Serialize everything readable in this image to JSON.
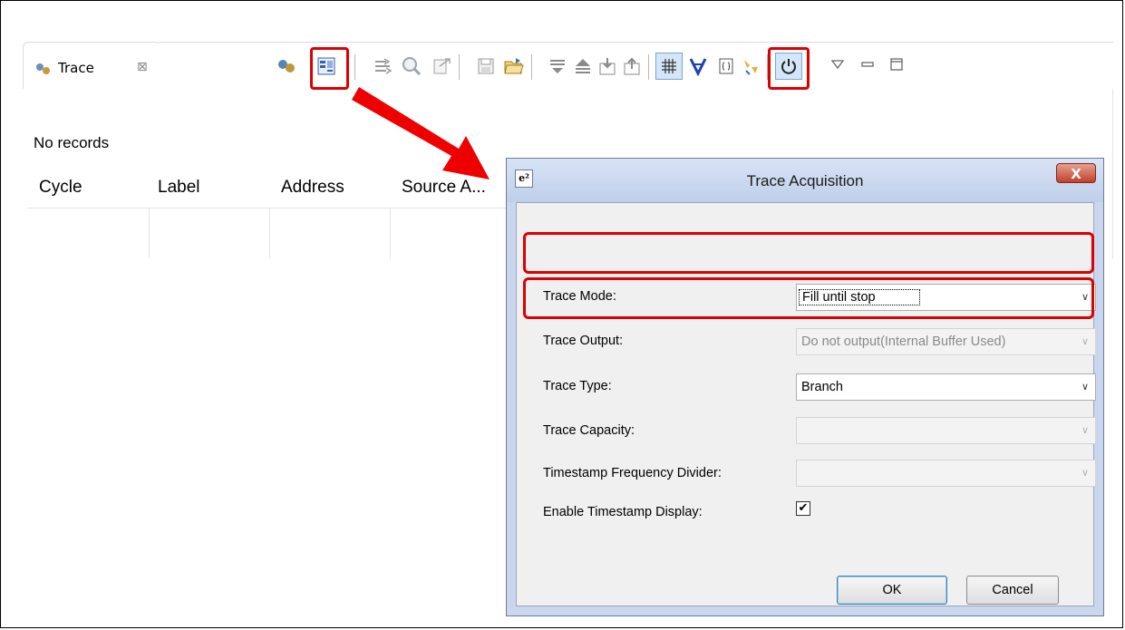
{
  "view": {
    "tab_label": "Trace",
    "tab_close": "⊠",
    "status": "No records",
    "columns": [
      "Cycle",
      "Label",
      "Address",
      "Source A..."
    ]
  },
  "toolbar": {
    "icons": [
      "connect-icon",
      "acquisition-settings-icon",
      "step-icon",
      "find-icon",
      "export-icon",
      "save-icon",
      "open-folder-icon",
      "filter-icon",
      "collapse-icon",
      "import-icon",
      "export-up-icon",
      "grid-icon",
      "v-marker-icon",
      "clear-icon",
      "highlight-icon",
      "power-icon",
      "view-menu-icon",
      "minimize-icon",
      "maximize-icon"
    ]
  },
  "dialog": {
    "title": "Trace Acquisition",
    "logo": "e²",
    "close": "X",
    "fields": {
      "trace_mode_label": "Trace Mode:",
      "trace_mode_value": "Fill until stop",
      "trace_output_label": "Trace Output:",
      "trace_output_value": "Do not output(Internal Buffer Used)",
      "trace_type_label": "Trace Type:",
      "trace_type_value": "Branch",
      "trace_capacity_label": "Trace Capacity:",
      "timestamp_divider_label": "Timestamp Frequency Divider:",
      "enable_timestamp_label": "Enable Timestamp Display:",
      "enable_timestamp_checked": true
    },
    "ok_label": "OK",
    "cancel_label": "Cancel"
  },
  "colors": {
    "highlight": "#dd0000",
    "arrow": "#ee0000"
  }
}
